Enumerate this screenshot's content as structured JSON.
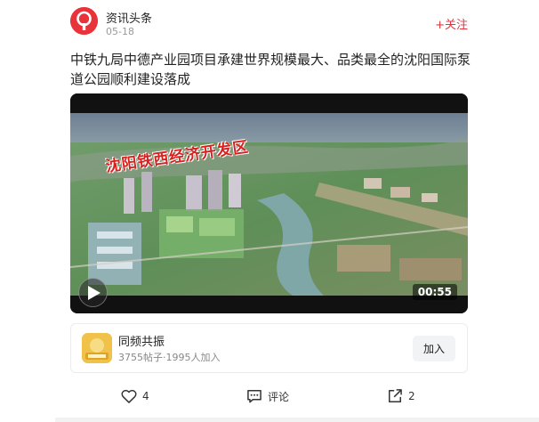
{
  "post": {
    "source": "资讯头条",
    "date": "05-18",
    "follow_label": "+关注",
    "title": "中铁九局中德产业园项目承建世界规模最大、品类最全的沈阳国际泵道公园顺利建设落成"
  },
  "video": {
    "overlay_text": "沈阳铁西经济开发区",
    "duration": "00:55"
  },
  "group": {
    "name": "同频共振",
    "stats": "3755帖子·1995人加入",
    "join_label": "加入"
  },
  "actions": {
    "like_count": "4",
    "comment_label": "评论",
    "share_count": "2"
  },
  "colors": {
    "accent_red": "#e8333a",
    "group_icon_bg": "#f1c24a"
  }
}
